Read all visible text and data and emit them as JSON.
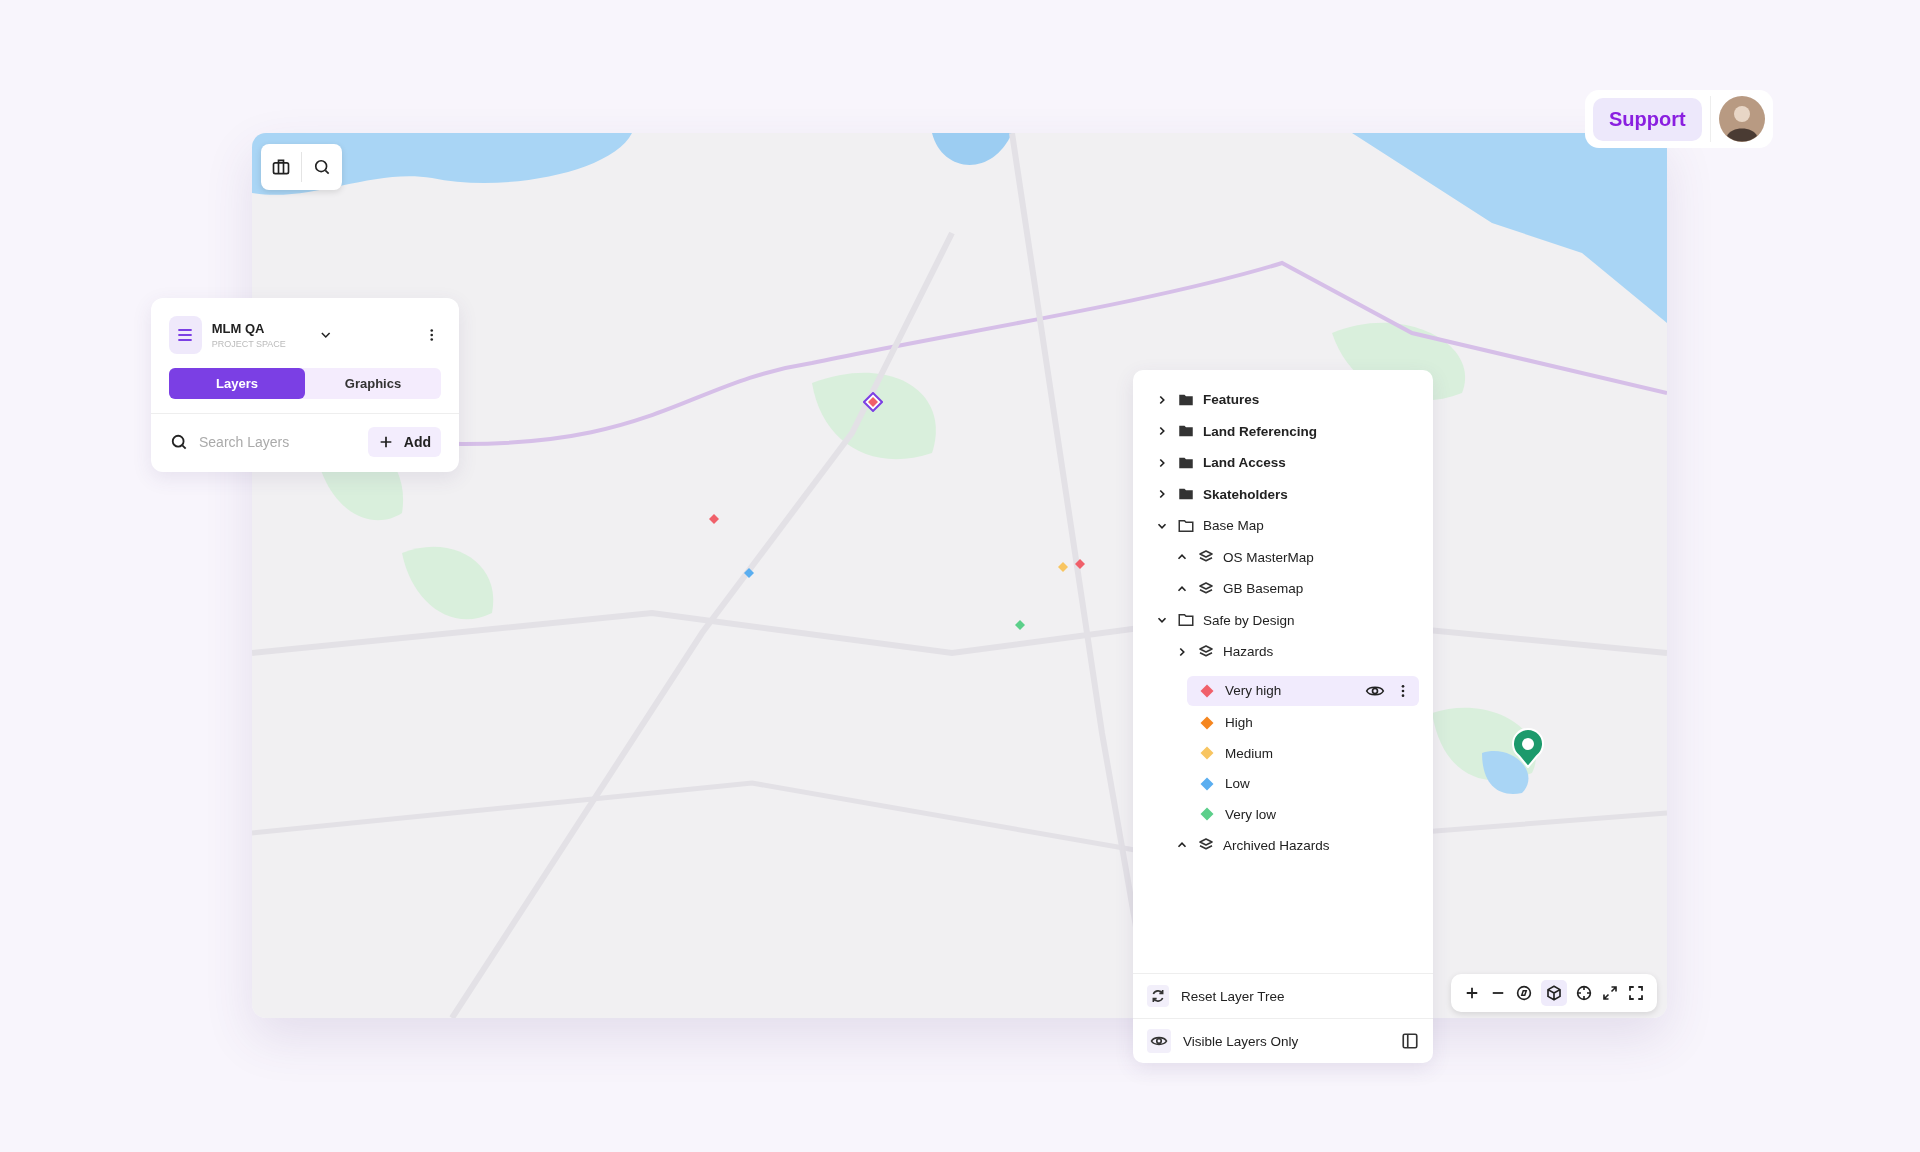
{
  "header": {
    "support_label": "Support"
  },
  "project_panel": {
    "title": "MLM QA",
    "subtitle": "PROJECT SPACE",
    "tabs": [
      {
        "label": "Layers",
        "selected": true
      },
      {
        "label": "Graphics",
        "selected": false
      }
    ],
    "search": {
      "placeholder": "Search Layers"
    },
    "add_label": "Add"
  },
  "layer_tree": [
    {
      "kind": "folder",
      "label": "Features",
      "expanded": false,
      "bold": true
    },
    {
      "kind": "folder",
      "label": "Land Referencing",
      "expanded": false,
      "bold": true
    },
    {
      "kind": "folder",
      "label": "Land Access",
      "expanded": false,
      "bold": true
    },
    {
      "kind": "folder",
      "label": "Skateholders",
      "expanded": false,
      "bold": true
    },
    {
      "kind": "folder",
      "label": "Base Map",
      "expanded": true,
      "bold": false,
      "children": [
        {
          "kind": "layer",
          "label": "OS MasterMap",
          "expanded": true
        },
        {
          "kind": "layer",
          "label": "GB Basemap",
          "expanded": true
        }
      ]
    },
    {
      "kind": "folder",
      "label": "Safe by Design",
      "expanded": true,
      "bold": false,
      "children": [
        {
          "kind": "layer",
          "label": "Hazards",
          "expanded": false,
          "children": [
            {
              "kind": "legend",
              "label": "Very high",
              "color": "#f0606a",
              "selected": true
            },
            {
              "kind": "legend",
              "label": "High",
              "color": "#f5861f",
              "selected": false
            },
            {
              "kind": "legend",
              "label": "Medium",
              "color": "#f8c561",
              "selected": false
            },
            {
              "kind": "legend",
              "label": "Low",
              "color": "#5aaef0",
              "selected": false
            },
            {
              "kind": "legend",
              "label": "Very low",
              "color": "#5ccf8a",
              "selected": false
            }
          ]
        },
        {
          "kind": "layer",
          "label": "Archived Hazards",
          "expanded": true
        }
      ]
    }
  ],
  "layer_footer": {
    "reset_label": "Reset Layer Tree",
    "visible_only_label": "Visible Layers Only"
  }
}
